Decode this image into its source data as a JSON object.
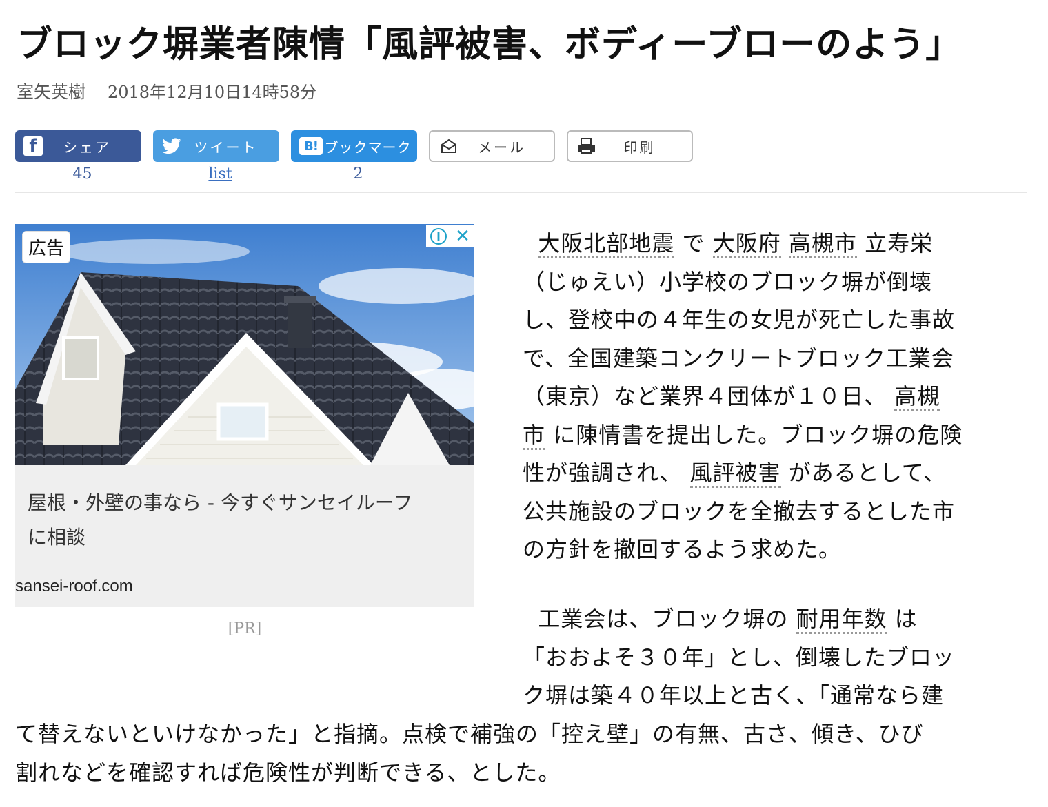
{
  "article": {
    "title": "ブロック塀業者陳情「風評被害、ボディーブローのよう」",
    "author": "室矢英樹",
    "date": "2018年12月10日14時58分"
  },
  "share": {
    "facebook": {
      "icon": "facebook-icon",
      "label": "シェア",
      "count": "45"
    },
    "twitter": {
      "icon": "twitter-icon",
      "label": "ツイート",
      "count": "list"
    },
    "hatena": {
      "icon": "hatena-bookmark-icon",
      "label": "ブックマーク",
      "count": "2"
    },
    "mail": {
      "icon": "mail-icon",
      "label": "メール"
    },
    "print": {
      "icon": "print-icon",
      "label": "印刷"
    }
  },
  "ad": {
    "badge": "広告",
    "headline_line1": "屋根・外壁の事なら - 今すぐサンセイルーフ",
    "headline_line2": "に相談",
    "domain": "sansei-roof.com",
    "pr_label": "[PR]"
  },
  "paragraph1": {
    "l1_kw1": "大阪北部地震",
    "l1_t1": "で",
    "l1_kw2": "大阪府",
    "l1_kw3": "高槻市",
    "l1_t2": "立寿栄",
    "l2": "（じゅえい）小学校のブロック塀が倒壊",
    "l3": "し、登校中の４年生の女児が死亡した事故",
    "l4": "で、全国建築コンクリートブロック工業会",
    "l5_t": "（東京）など業界４団体が１０日、",
    "l5_kw": "高槻",
    "l6_kw": "市",
    "l6_t": "に陳情書を提出した。ブロック塀の危険",
    "l7_t1": "性が強調され、",
    "l7_kw": "風評被害",
    "l7_t2": "があるとして、",
    "l8": "公共施設のブロックを全撤去するとした市",
    "l9": "の方針を撤回するよう求めた。"
  },
  "paragraph2": {
    "l1_t1": "工業会は、ブロック塀の",
    "l1_kw": "耐用年数",
    "l1_t2": "は",
    "l2": "「おおよそ３０年」とし、倒壊したブロッ",
    "l3": "ク塀は築４０年以上と古く、「通常なら建",
    "l4": "て替えないといけなかった」と指摘。点検で補強の「控え壁」の有無、古さ、傾き、ひび",
    "l5": "割れなどを確認すれば危険性が判断できる、とした。"
  }
}
